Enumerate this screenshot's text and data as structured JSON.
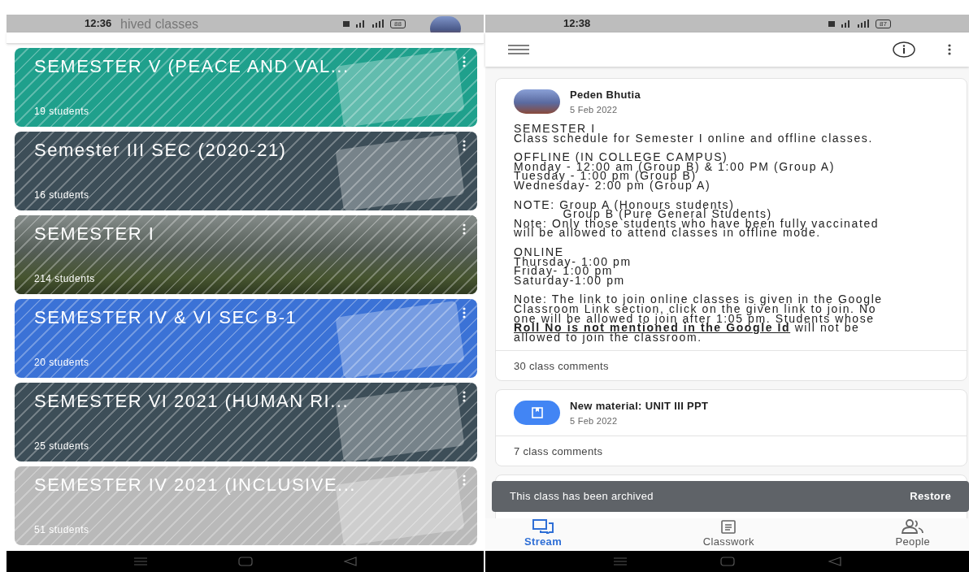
{
  "left_screen": {
    "status_bar": {
      "time": "12:36",
      "battery": "88"
    },
    "app_bar": {
      "title": "hived classes"
    },
    "classes": [
      {
        "name": "SEMESTER V (PEACE AND VAL...",
        "students": "19 students",
        "color": "#1fa08c",
        "kind": "illustration"
      },
      {
        "name": "Semester III SEC (2020-21)",
        "students": "16 students",
        "color": "#3d4e58",
        "kind": "illustration"
      },
      {
        "name": "SEMESTER I",
        "students": "214 students",
        "color": "#2f3a30",
        "kind": "photo"
      },
      {
        "name": "SEMESTER IV & VI SEC B-1",
        "students": "20 students",
        "color": "#3b72d6",
        "kind": "illustration"
      },
      {
        "name": "SEMESTER VI 2021 (HUMAN RI...",
        "students": "25 students",
        "color": "#3d4e58",
        "kind": "illustration"
      },
      {
        "name": "SEMESTER IV 2021 (INCLUSIVE...",
        "students": "51 students",
        "color": "#b9b9b9",
        "kind": "illustration"
      }
    ]
  },
  "right_screen": {
    "status_bar": {
      "time": "12:38",
      "battery": "87"
    },
    "posts": [
      {
        "kind": "announcement",
        "author": "Peden Bhutia",
        "date": "5 Feb 2022",
        "paragraphs": [
          [
            "SEMESTER I",
            "Class schedule for Semester I online and offline classes."
          ],
          [
            "OFFLINE (IN COLLEGE CAMPUS)",
            "Monday - 12:00 am (Group B) & 1:00 PM (Group A)",
            "Tuesday - 1:00 pm (Group B)",
            "Wednesday- 2:00 pm (Group A)"
          ],
          [
            "NOTE: Group A (Honours students)",
            "           Group B (Pure General Students)",
            "Note: Only those students who have been fully vaccinated",
            "will be allowed to attend classes in offline mode."
          ],
          [
            "ONLINE",
            "Thursday- 1:00 pm",
            "Friday- 1:00 pm",
            "Saturday-1:00 pm"
          ],
          [
            "Note: The link to join online classes is given in the Google",
            "Classroom Link section, click on the given link to join. No",
            "one will be allowed to join after 1:05 pm. Students whose",
            "**Roll No is not mentioned in the Google Id** will not be",
            "allowed to join the classroom."
          ]
        ],
        "comments": "30 class comments"
      },
      {
        "kind": "material",
        "title": "New material: UNIT III PPT",
        "date": "5 Feb 2022",
        "comments": "7 class comments"
      },
      {
        "kind": "partial"
      }
    ],
    "snackbar": {
      "message": "This class has been archived",
      "action": "Restore"
    },
    "bottom_nav": [
      {
        "label": "Stream",
        "selected": true,
        "kind": "stream"
      },
      {
        "label": "Classwork",
        "selected": false,
        "kind": "classwork"
      },
      {
        "label": "People",
        "selected": false,
        "kind": "people"
      }
    ]
  }
}
